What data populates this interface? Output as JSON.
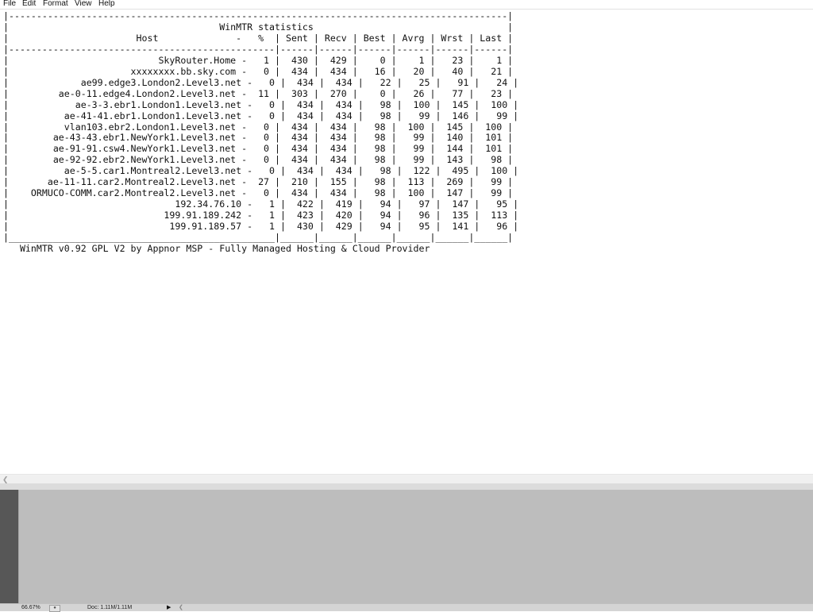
{
  "menu": {
    "file": "File",
    "edit": "Edit",
    "format": "Format",
    "view": "View",
    "help": "Help"
  },
  "winmtr_text": "|------------------------------------------------------------------------------------------|\n|                                      WinMTR statistics                                   |\n|                       Host              -   %  | Sent | Recv | Best | Avrg | Wrst | Last |\n|------------------------------------------------|------|------|------|------|------|------|\n|                           SkyRouter.Home -   1 |  430 |  429 |    0 |    1 |   23 |    1 |\n|                      xxxxxxxx.bb.sky.com -   0 |  434 |  434 |   16 |   20 |   40 |   21 |\n|             ae99.edge3.London2.Level3.net -   0 |  434 |  434 |   22 |   25 |   91 |   24 |\n|         ae-0-11.edge4.London2.Level3.net -  11 |  303 |  270 |    0 |   26 |   77 |   23 |\n|            ae-3-3.ebr1.London1.Level3.net -   0 |  434 |  434 |   98 |  100 |  145 |  100 |\n|          ae-41-41.ebr1.London1.Level3.net -   0 |  434 |  434 |   98 |   99 |  146 |   99 |\n|          vlan103.ebr2.London1.Level3.net -   0 |  434 |  434 |   98 |  100 |  145 |  100 |\n|        ae-43-43.ebr1.NewYork1.Level3.net -   0 |  434 |  434 |   98 |   99 |  140 |  101 |\n|        ae-91-91.csw4.NewYork1.Level3.net -   0 |  434 |  434 |   98 |   99 |  144 |  101 |\n|        ae-92-92.ebr2.NewYork1.Level3.net -   0 |  434 |  434 |   98 |   99 |  143 |   98 |\n|          ae-5-5.car1.Montreal2.Level3.net -   0 |  434 |  434 |   98 |  122 |  495 |  100 |\n|       ae-11-11.car2.Montreal2.Level3.net -  27 |  210 |  155 |   98 |  113 |  269 |   99 |\n|    ORMUCO-COMM.car2.Montreal2.Level3.net -   0 |  434 |  434 |   98 |  100 |  147 |   99 |\n|                              192.34.76.10 -   1 |  422 |  419 |   94 |   97 |  147 |   95 |\n|                            199.91.189.242 -   1 |  423 |  420 |   94 |   96 |  135 |  113 |\n|                             199.91.189.57 -   1 |  430 |  429 |   94 |   95 |  141 |   96 |\n|________________________________________________|______|______|______|______|______|______|\n   WinMTR v0.92 GPL V2 by Appnor MSP - Fully Managed Hosting & Cloud Provider",
  "status": {
    "zoom": "66.67%",
    "doc": "Doc: 1.11M/1.11M"
  }
}
